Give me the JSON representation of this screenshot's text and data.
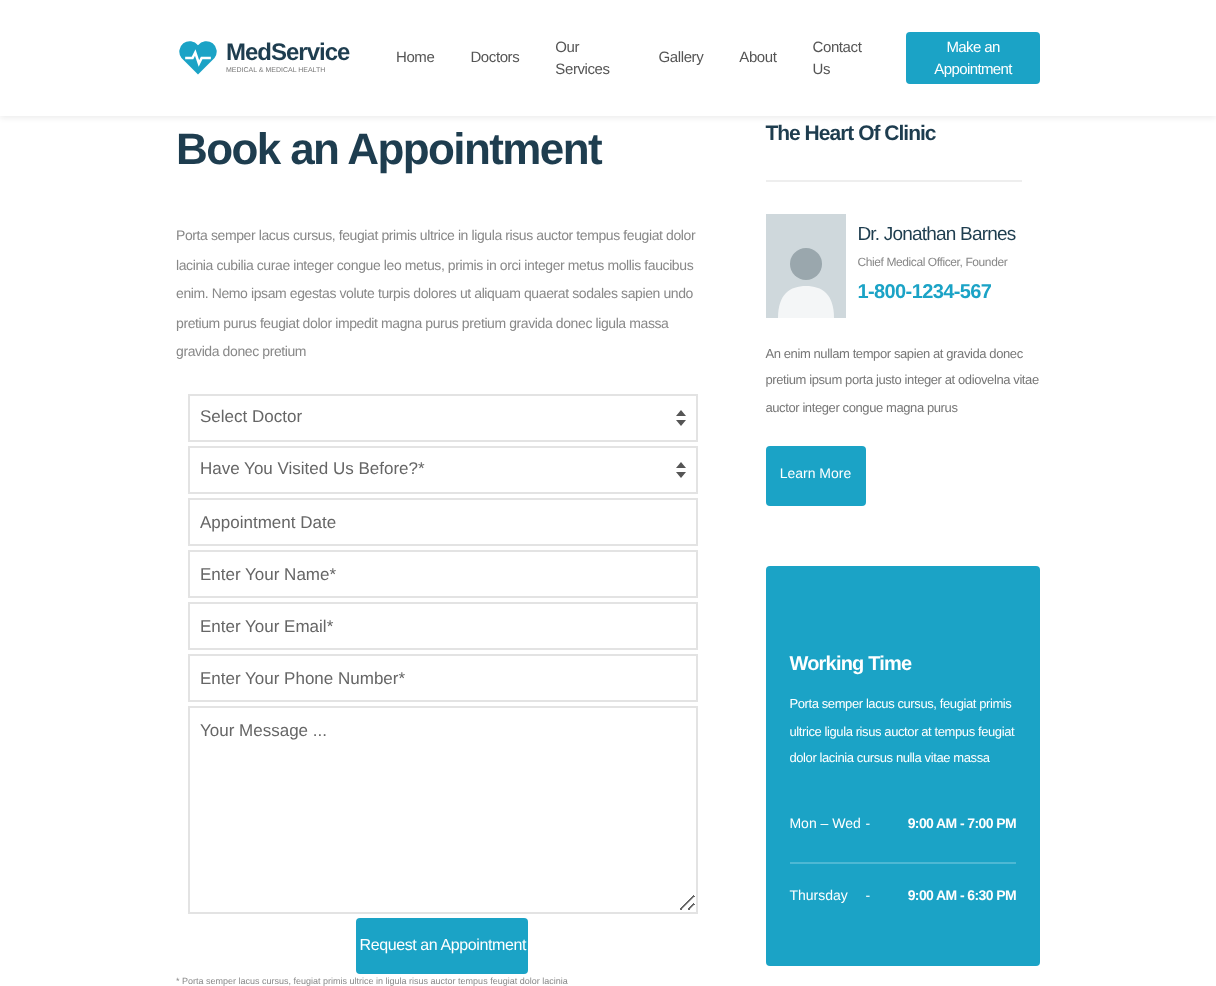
{
  "header": {
    "logo": {
      "name": "MedService",
      "tagline": "MEDICAL & MEDICAL HEALTH"
    },
    "nav": [
      {
        "label": "Home"
      },
      {
        "label": "Doctors"
      },
      {
        "label": "Our Services"
      },
      {
        "label": "Gallery"
      },
      {
        "label": "About"
      },
      {
        "label": "Contact Us"
      }
    ],
    "cta": "Make an Appointment"
  },
  "main": {
    "title": "Book an Appointment",
    "intro": "Porta semper lacus cursus, feugiat primis ultrice in ligula risus auctor tempus feugiat dolor lacinia cubilia curae integer congue leo metus, primis in orci integer metus mollis faucibus enim. Nemo ipsam egestas volute turpis dolores ut aliquam quaerat sodales sapien undo pretium purus feugiat dolor impedit magna purus pretium gravida donec ligula massa gravida donec pretium",
    "fields": [
      {
        "kind": "select",
        "placeholder": "Select Doctor"
      },
      {
        "kind": "select",
        "placeholder": "Have You Visited Us Before?*"
      },
      {
        "kind": "input",
        "placeholder": "Appointment Date"
      },
      {
        "kind": "input",
        "placeholder": "Enter Your Name*"
      },
      {
        "kind": "input",
        "placeholder": "Enter Your Email*"
      },
      {
        "kind": "input",
        "placeholder": "Enter Your Phone Number*"
      },
      {
        "kind": "textarea",
        "placeholder": "Your Message ..."
      }
    ],
    "submit": "Request an Appointment",
    "footnote": "* Porta semper lacus cursus, feugiat primis ultrice in ligula risus auctor tempus feugiat dolor lacinia"
  },
  "sidebar": {
    "title": "The Heart Of Clinic",
    "doctor": {
      "name": "Dr. Jonathan Barnes",
      "role": "Chief Medical Officer, Founder",
      "phone": "1-800-1234-567"
    },
    "bio": "An enim nullam tempor sapien at gravida donec pretium ipsum porta justo integer at odiovelna vitae auctor integer congue magna purus",
    "button": "Learn More",
    "working_time": {
      "title": "Working Time",
      "text": "Porta semper lacus cursus, feugiat primis ultrice ligula risus auctor at tempus feugiat dolor lacinia cursus nulla vitae massa",
      "hours": [
        {
          "days": "Mon – Wed",
          "separator": "-",
          "time": "9:00 AM - 7:00 PM"
        },
        {
          "days": "Thursday",
          "separator": "-",
          "time": "9:00 AM - 6:30 PM"
        }
      ]
    }
  }
}
